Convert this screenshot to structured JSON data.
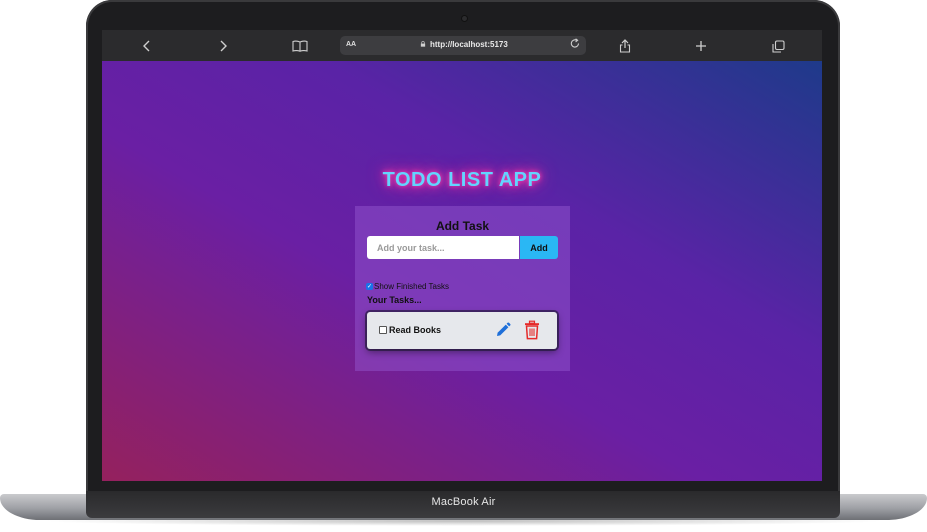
{
  "device": {
    "label": "MacBook Air"
  },
  "browser": {
    "text_size_label": "AA",
    "url": "http://localhost:5173",
    "icons": {
      "back": "chevron-left-icon",
      "forward": "chevron-right-icon",
      "bookmarks": "book-icon",
      "lock": "lock-icon",
      "reload": "reload-icon",
      "share": "share-icon",
      "new_tab": "plus-icon",
      "tabs": "tabs-icon"
    }
  },
  "app": {
    "title": "TODO LIST APP",
    "add_task": {
      "heading": "Add Task",
      "placeholder": "Add your task...",
      "value": "",
      "button_label": "Add"
    },
    "show_finished": {
      "label": "Show Finished Tasks",
      "checked": true
    },
    "tasks_heading": "Your Tasks...",
    "tasks": [
      {
        "text": "Read Books",
        "done": false,
        "edit_icon": "pencil-icon",
        "delete_icon": "trash-icon"
      }
    ]
  },
  "colors": {
    "title_text": "#63d4ff",
    "title_glow": "#ff3ca8",
    "add_button": "#2ab7f4",
    "edit_icon": "#1e6fd9",
    "delete_icon": "#e52a2a"
  }
}
